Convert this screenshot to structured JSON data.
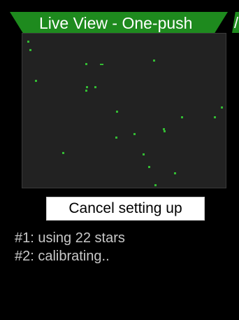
{
  "header": {
    "title": "Live View - One-push",
    "next_tab_fragment": "/"
  },
  "live_view": {
    "star_color": "#33bb33",
    "star_count": 22
  },
  "actions": {
    "cancel_label": "Cancel setting up"
  },
  "status": {
    "line1": "#1: using 22 stars",
    "line2": "#2: calibrating.."
  }
}
